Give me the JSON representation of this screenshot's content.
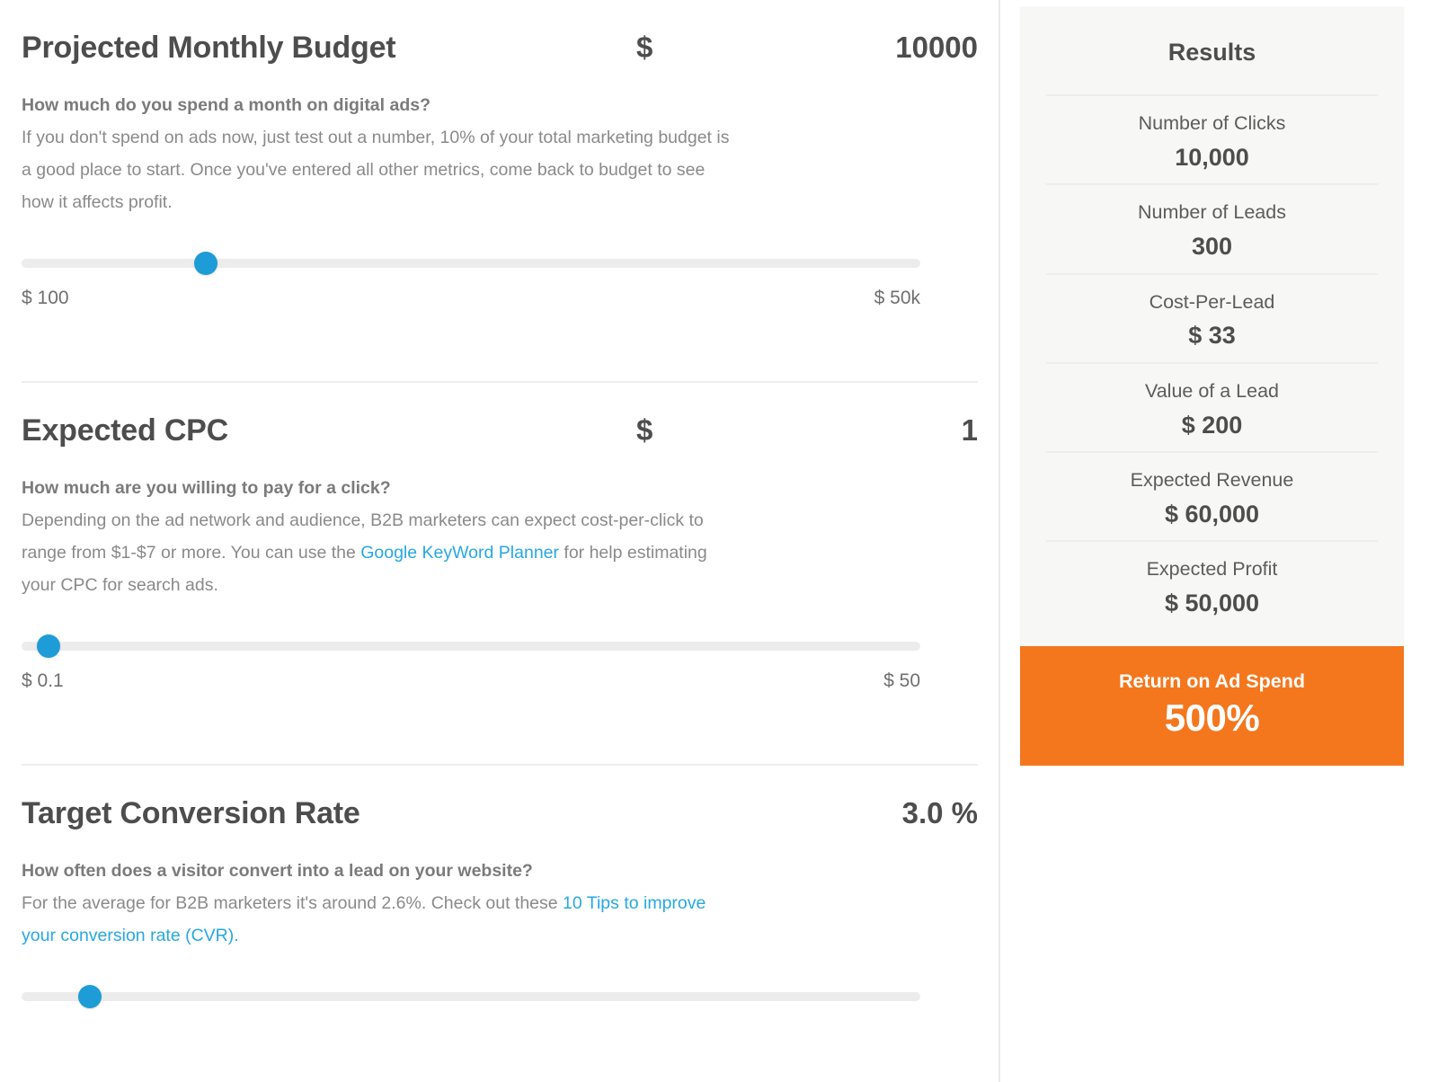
{
  "sections": [
    {
      "title": "Projected Monthly Budget",
      "currency": "$",
      "value": "10000",
      "question": "How much do you spend a month on digital ads?",
      "help_before": "If you don't spend on ads now, just test out a number, 10% of your total marketing budget is a good place to start. Once you've entered all other metrics, come back to budget to see how it affects profit.",
      "slider": {
        "min_label": "$ 100",
        "max_label": "$ 50k",
        "thumb_percent": 20.5
      }
    },
    {
      "title": "Expected CPC",
      "currency": "$",
      "value": "1",
      "question": "How much are you willing to pay for a click?",
      "help_before": "Depending on the ad network and audience, B2B marketers can expect cost-per-click to range from $1-$7 or more. You can use the ",
      "help_link": "Google KeyWord Planner",
      "help_after": " for help estimating your CPC for search ads.",
      "slider": {
        "min_label": "$ 0.1",
        "max_label": "$ 50",
        "thumb_percent": 3.0
      }
    },
    {
      "title": "Target Conversion Rate",
      "value_pct": "3.0 %",
      "question": "How often does a visitor convert into a lead on your website?",
      "help_before": "For the average for B2B marketers it's around 2.6%. Check out these ",
      "help_link": "10 Tips to improve your conversion rate (CVR).",
      "help_after": "",
      "slider": {
        "thumb_percent": 7.6
      }
    }
  ],
  "results": {
    "title": "Results",
    "rows": [
      {
        "label": "Number of Clicks",
        "value": "10,000"
      },
      {
        "label": "Number of Leads",
        "value": "300"
      },
      {
        "label": "Cost-Per-Lead",
        "value": "$ 33"
      },
      {
        "label": "Value of a Lead",
        "value": "$ 200"
      },
      {
        "label": "Expected Revenue",
        "value": "$ 60,000"
      },
      {
        "label": "Expected Profit",
        "value": "$ 50,000"
      }
    ],
    "roas": {
      "label": "Return on Ad Spend",
      "value": "500%"
    }
  },
  "colors": {
    "accent_blue": "#1e9cd7",
    "link_blue": "#27a8e0",
    "roas_orange": "#f4771e",
    "panel_bg": "#f7f7f5",
    "text_dark": "#4d4d4d",
    "text_muted": "#8a8a8a"
  }
}
